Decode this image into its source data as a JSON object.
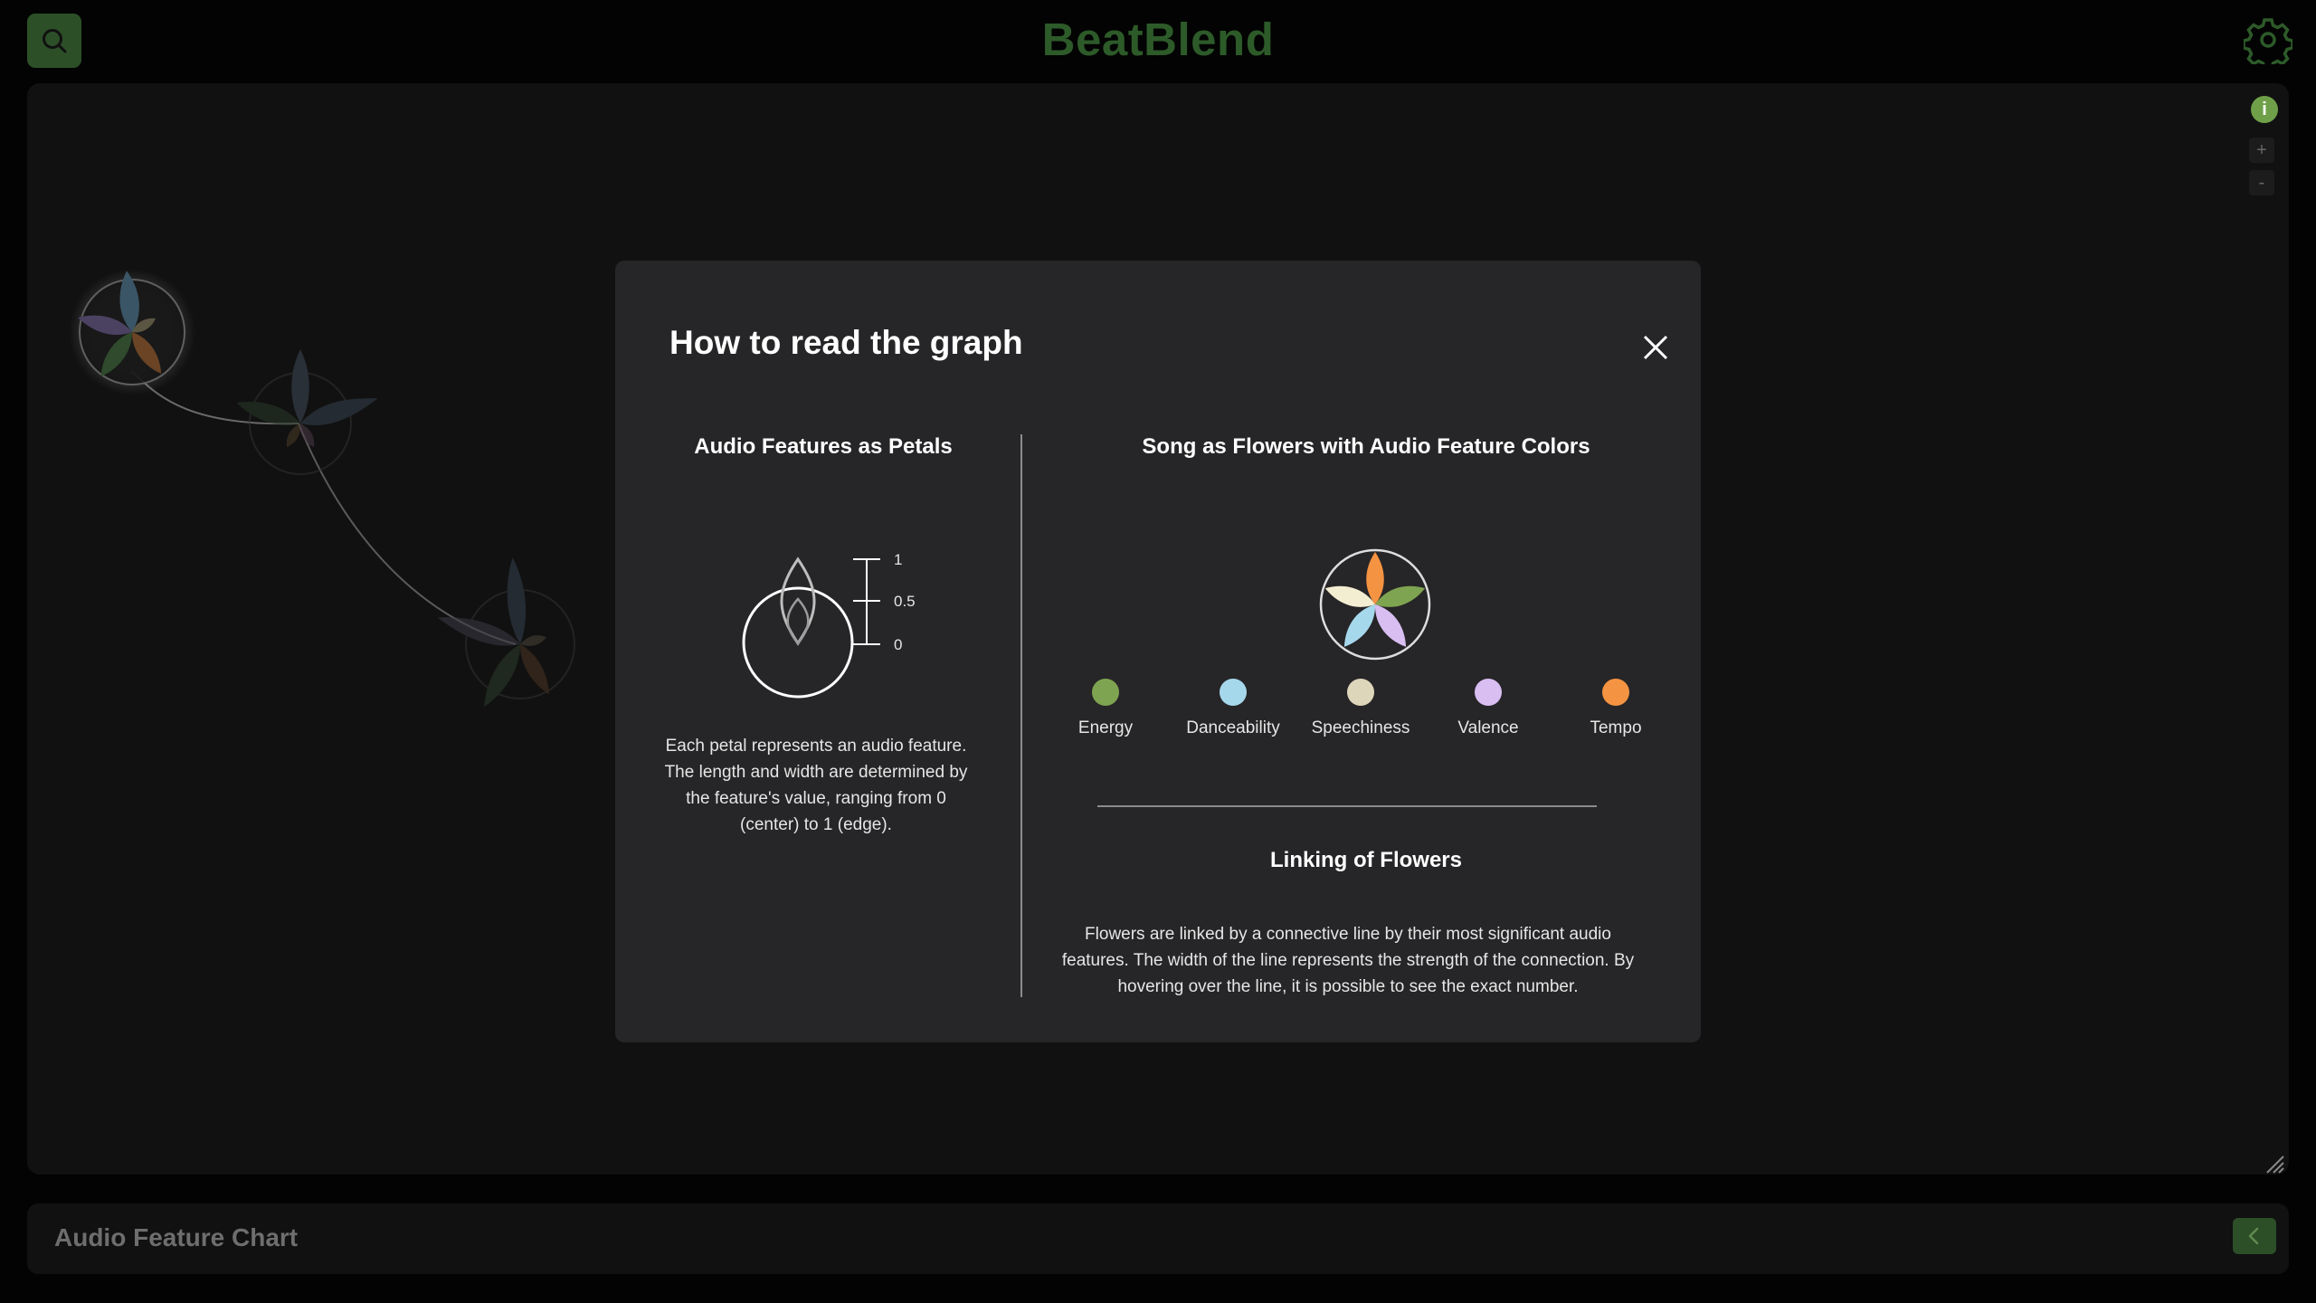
{
  "app": {
    "title": "BeatBlend",
    "search_icon": "search-icon",
    "settings_icon": "gear-icon",
    "accent_color": "#2c4f28"
  },
  "canvas": {
    "info_label": "i",
    "zoom_in_label": "+",
    "zoom_out_label": "-"
  },
  "modal": {
    "title": "How to read the graph",
    "close_icon": "close-icon",
    "petals_section": {
      "heading": "Audio Features as Petals",
      "scale_ticks": [
        "1",
        "0.5",
        "0"
      ],
      "description": "Each petal represents an audio feature. The length and width are determined by the feature's value, ranging from 0 (center) to 1 (edge)."
    },
    "flowers_section": {
      "heading": "Song as Flowers with Audio Feature Colors",
      "features": [
        {
          "label": "Energy",
          "color": "#7fa451"
        },
        {
          "label": "Danceability",
          "color": "#a6d8ec"
        },
        {
          "label": "Speechiness",
          "color": "#ddd6bb"
        },
        {
          "label": "Valence",
          "color": "#d8bef1"
        },
        {
          "label": "Tempo",
          "color": "#f49342"
        }
      ]
    },
    "linking_section": {
      "heading": "Linking of Flowers",
      "description": "Flowers are linked by a connective line by their most significant audio features. The width of the line represents the strength of the connection. By hovering over the line, it is possible to see the exact number."
    }
  },
  "bottom_panel": {
    "title": "Audio Feature Chart",
    "toggle_icon": "chevron-left-icon"
  }
}
